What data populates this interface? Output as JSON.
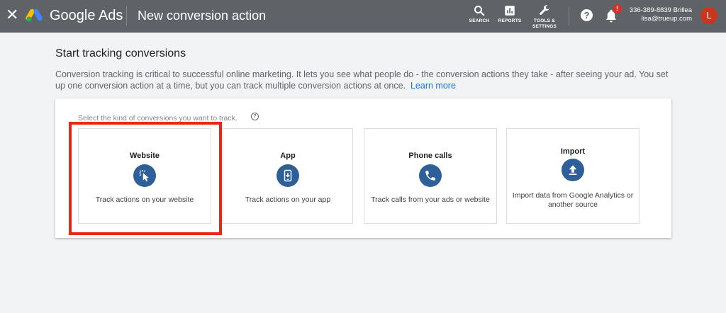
{
  "topbar": {
    "brand": "Google Ads",
    "title": "New conversion action",
    "tools": [
      {
        "label": "SEARCH",
        "icon": "search-icon"
      },
      {
        "label": "REPORTS",
        "icon": "reports-icon"
      },
      {
        "label": "TOOLS & SETTINGS",
        "icon": "wrench-icon"
      }
    ],
    "help": "?",
    "notification_badge": "!",
    "account": {
      "phone": "336-389-8839 Brillea",
      "email": "lisa@trueup.com",
      "avatar_letter": "L"
    }
  },
  "main": {
    "heading": "Start tracking conversions",
    "description": "Conversion tracking is critical to successful online marketing. It lets you see what people do - the conversion actions they take - after seeing your ad. You set up one conversion action at a time, but you can track multiple conversion actions at once.",
    "learn_more": "Learn more",
    "prompt": "Select the kind of conversions you want to track.",
    "help_glyph": "?",
    "options": [
      {
        "title": "Website",
        "description": "Track actions on your website",
        "icon": "cursor-click-icon"
      },
      {
        "title": "App",
        "description": "Track actions on your app",
        "icon": "mobile-app-icon"
      },
      {
        "title": "Phone calls",
        "description": "Track calls from your ads or website",
        "icon": "phone-icon"
      },
      {
        "title": "Import",
        "description": "Import data from Google Analytics or another source",
        "icon": "upload-icon"
      }
    ]
  },
  "colors": {
    "topbar": "#5f6368",
    "icon_circle": "#2e5f99",
    "highlight": "#ea2616",
    "link": "#1a73e8",
    "avatar": "#c8371c"
  }
}
